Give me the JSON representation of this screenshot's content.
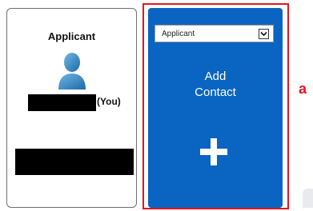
{
  "applicant_card": {
    "title": "Applicant",
    "you_label": "(You)",
    "avatar_icon": "person-avatar-icon"
  },
  "add_contact_card": {
    "role_select": {
      "selected": "Applicant",
      "arrow_icon": "chevron-down-icon"
    },
    "label_line1": "Add",
    "label_line2": "Contact",
    "plus_icon": "plus-icon"
  },
  "annotation": {
    "letter": "a"
  },
  "colors": {
    "card_blue": "#0a64c2",
    "highlight_red": "#e8141b",
    "avatar_blue": "#3a87c2",
    "redaction": "#000000"
  }
}
